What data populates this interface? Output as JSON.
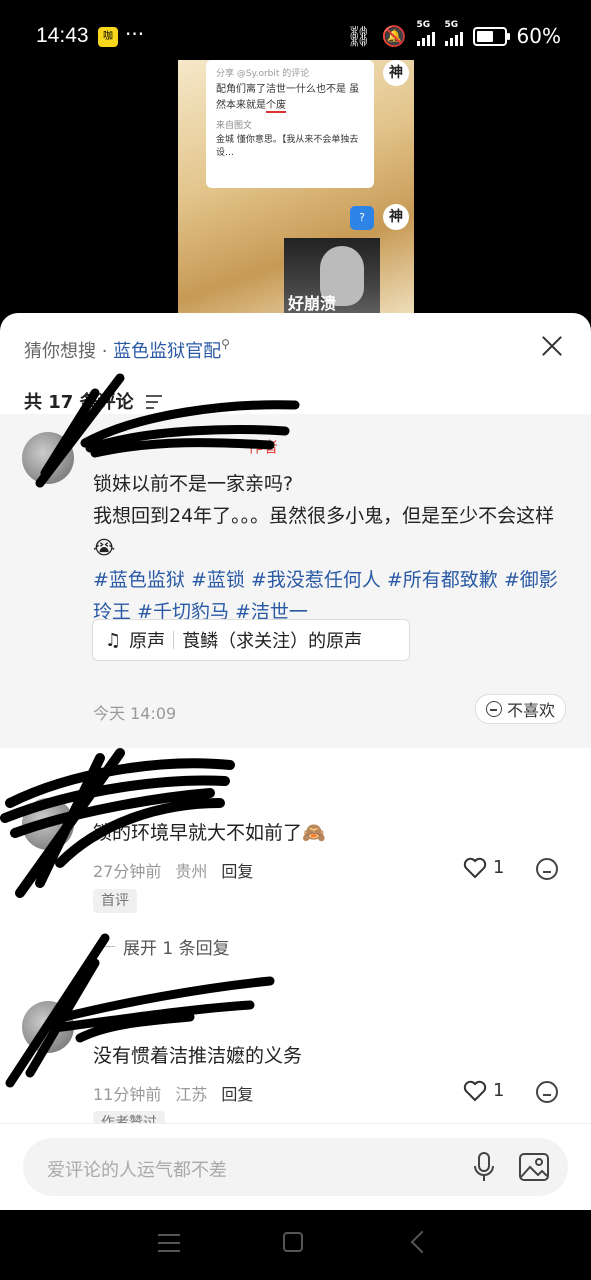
{
  "status": {
    "time": "14:43",
    "app_badge": "咖",
    "more": "···",
    "net1": "5G",
    "net2": "5G",
    "battery": "60%"
  },
  "video": {
    "share_line": "分享 @Sy.orbit 的评论",
    "comment_line1": "配角们离了洁世一什么也不是 虽",
    "comment_line2": "然本来就是",
    "comment_underlined": "个废",
    "from_label": "来自图文",
    "quoted_text": "金城 懂你意思。【我从来不会单独去设…",
    "god_label": "神",
    "question_mark": "?",
    "manga_caption": "好崩溃"
  },
  "panel": {
    "guess_prefix": "猜你想搜 · ",
    "guess_query": "蓝色监狱官配",
    "comment_count": "共 17 条评论"
  },
  "author_comment": {
    "tag": "作者",
    "line1": "锁妹以前不是一家亲吗?",
    "line2": "我想回到24年了。。。虽然很多小鬼，但是至少不会这样😭",
    "hashtags": "#蓝色监狱 #蓝锁 #我没惹任何人 #所有都致歉 #御影玲王 #千切豹马 #洁世一",
    "music_label": "原声",
    "music_source": "莨鳞（求关注）的原声",
    "time": "今天 14:09",
    "dislike_label": "不喜欢"
  },
  "comments": [
    {
      "text": "锁的环境早就大不如前了🙈",
      "time": "27分钟前",
      "location": "贵州",
      "reply": "回复",
      "likes": "1",
      "tag": "首评"
    },
    {
      "text": "没有惯着洁推洁嬷的义务",
      "time": "11分钟前",
      "location": "江苏",
      "reply": "回复",
      "likes": "1",
      "tag": "作者赞过"
    }
  ],
  "expand_label": "展开 1 条回复",
  "input": {
    "placeholder": "爱评论的人运气都不差"
  }
}
